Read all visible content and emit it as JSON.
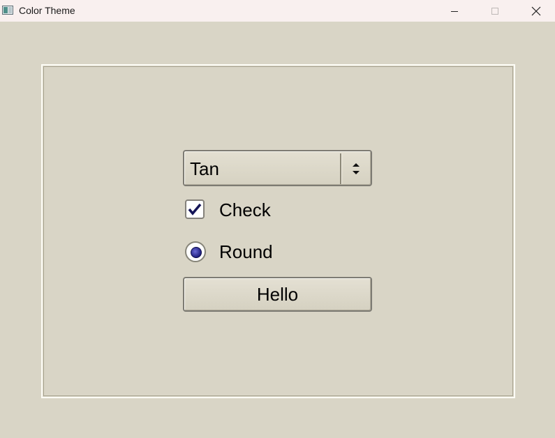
{
  "window": {
    "title": "Color Theme",
    "controls": {
      "minimize": "minimize-icon",
      "maximize": "maximize-icon",
      "close": "close-icon"
    }
  },
  "form": {
    "theme_select": {
      "value": "Tan",
      "icon": "spinner-arrows-icon"
    },
    "checkbox": {
      "label": "Check",
      "checked": true
    },
    "radio": {
      "label": "Round",
      "selected": true
    },
    "button": {
      "label": "Hello"
    }
  },
  "colors": {
    "background": "#d9d5c6",
    "titlebar": "#f9f0ef",
    "accent": "#20207f"
  }
}
